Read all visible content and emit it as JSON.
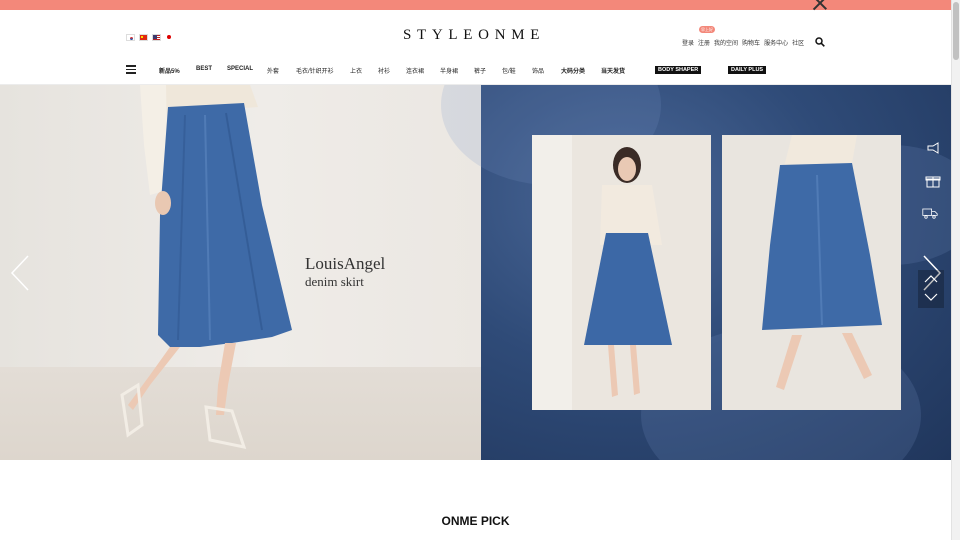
{
  "promo": {
    "close_label": ""
  },
  "header": {
    "logo": "STYLEONME",
    "flags": [
      "kr-flag-icon",
      "cn-flag-icon",
      "us-flag-icon",
      "jp-flag-icon"
    ],
    "badge": "早上好",
    "utility_links": [
      "登录",
      "注册",
      "我的空间",
      "购物车",
      "服务中心",
      "社区"
    ]
  },
  "nav": {
    "items": [
      "新品5%",
      "BEST",
      "SPECIAL",
      "外套",
      "毛衣/针织开衫",
      "上衣",
      "衬衫",
      "连衣裙",
      "半身裙",
      "裤子",
      "包/鞋",
      "饰品",
      "大码分类",
      "当天发货"
    ],
    "tags": [
      "BODY SHAPER",
      "DAILY PLUS"
    ]
  },
  "banner": {
    "title": "LouisAngel",
    "subtitle": "denim skirt"
  },
  "section": {
    "title": "ONME PICK"
  },
  "colors": {
    "accent": "#f3887a",
    "denim": "#2f4b78"
  }
}
